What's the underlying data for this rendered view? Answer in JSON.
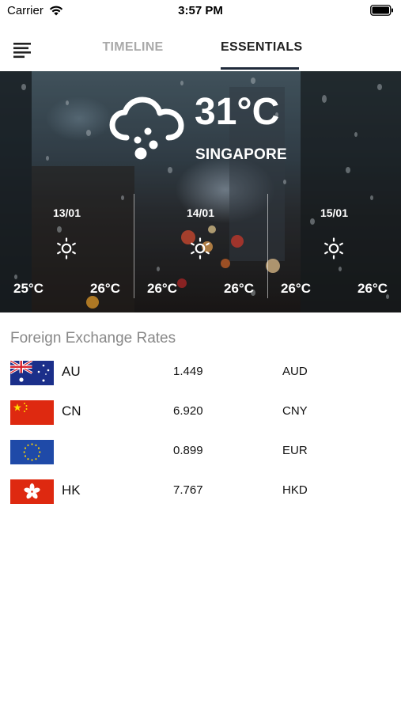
{
  "status_bar": {
    "carrier": "Carrier",
    "time": "3:57 PM"
  },
  "nav": {
    "menu_icon": "menu-icon",
    "tabs": [
      {
        "label": "TIMELINE",
        "active": false
      },
      {
        "label": "ESSENTIALS",
        "active": true
      }
    ]
  },
  "weather": {
    "icon": "cloud-snow-icon",
    "current_temp": "31°C",
    "city": "SINGAPORE",
    "forecast": [
      {
        "date": "13/01",
        "icon": "sun-icon",
        "low": "25°C",
        "high": "26°C"
      },
      {
        "date": "14/01",
        "icon": "sun-icon",
        "low": "26°C",
        "high": "26°C"
      },
      {
        "date": "15/01",
        "icon": "sun-icon",
        "low": "26°C",
        "high": "26°C"
      }
    ]
  },
  "fx": {
    "title": "Foreign Exchange Rates",
    "rows": [
      {
        "flag": "australia-flag-icon",
        "code": "AU",
        "rate": "1.449",
        "currency": "AUD"
      },
      {
        "flag": "china-flag-icon",
        "code": "CN",
        "rate": "6.920",
        "currency": "CNY"
      },
      {
        "flag": "eu-flag-icon",
        "code": "",
        "rate": "0.899",
        "currency": "EUR"
      },
      {
        "flag": "hong-kong-flag-icon",
        "code": "HK",
        "rate": "7.767",
        "currency": "HKD"
      }
    ]
  },
  "colors": {
    "tab_active": "#222222",
    "tab_inactive": "#a9a9a9",
    "tab_underline": "#1f2a3a",
    "fx_title": "#888888"
  }
}
